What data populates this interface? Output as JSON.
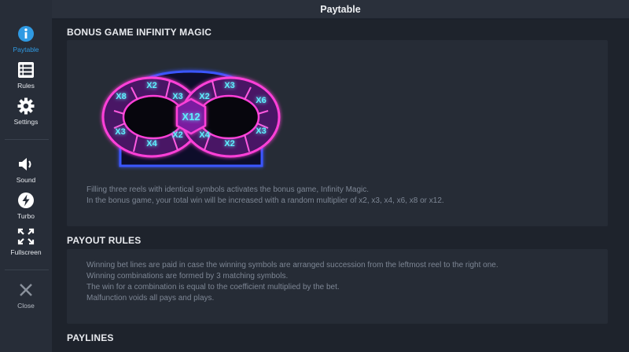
{
  "header": {
    "title": "Paytable"
  },
  "sidebar": {
    "items": [
      {
        "label": "Paytable",
        "icon": "info-icon"
      },
      {
        "label": "Rules",
        "icon": "list-icon"
      },
      {
        "label": "Settings",
        "icon": "gear-icon"
      },
      {
        "label": "Sound",
        "icon": "speaker-icon"
      },
      {
        "label": "Turbo",
        "icon": "lightning-icon"
      },
      {
        "label": "Fullscreen",
        "icon": "fullscreen-icon"
      },
      {
        "label": "Close",
        "icon": "close-icon"
      }
    ],
    "accent": "#2f9ae3"
  },
  "bonus": {
    "title": "BONUS GAME INFINITY MAGIC",
    "multipliers": {
      "left_loop": [
        "X8",
        "X2",
        "X3",
        "X3",
        "X4",
        "X2"
      ],
      "center": "X12",
      "right_loop": [
        "X2",
        "X3",
        "X6",
        "X3",
        "X2",
        "X4"
      ]
    },
    "lines": [
      "Filling three reels with identical symbols activates the bonus game, Infinity Magic.",
      "In the bonus game, your total win will be increased with a random multiplier of x2, x3, x4, x6, x8 or x12."
    ]
  },
  "payout": {
    "title": "PAYOUT RULES",
    "lines": [
      "Winning bet lines are paid in case the winning symbols are arranged succession from the leftmost reel to the right one.",
      "Winning combinations are formed by 3 matching symbols.",
      "The win for a combination is equal to the coefficient multiplied by the bet.",
      "Malfunction voids all pays and plays."
    ]
  },
  "paylines": {
    "title": "PAYLINES"
  },
  "colors": {
    "neon_pink": "#ff3fd8",
    "neon_blue": "#3a57ff",
    "neon_cyan": "#44e6ff"
  }
}
